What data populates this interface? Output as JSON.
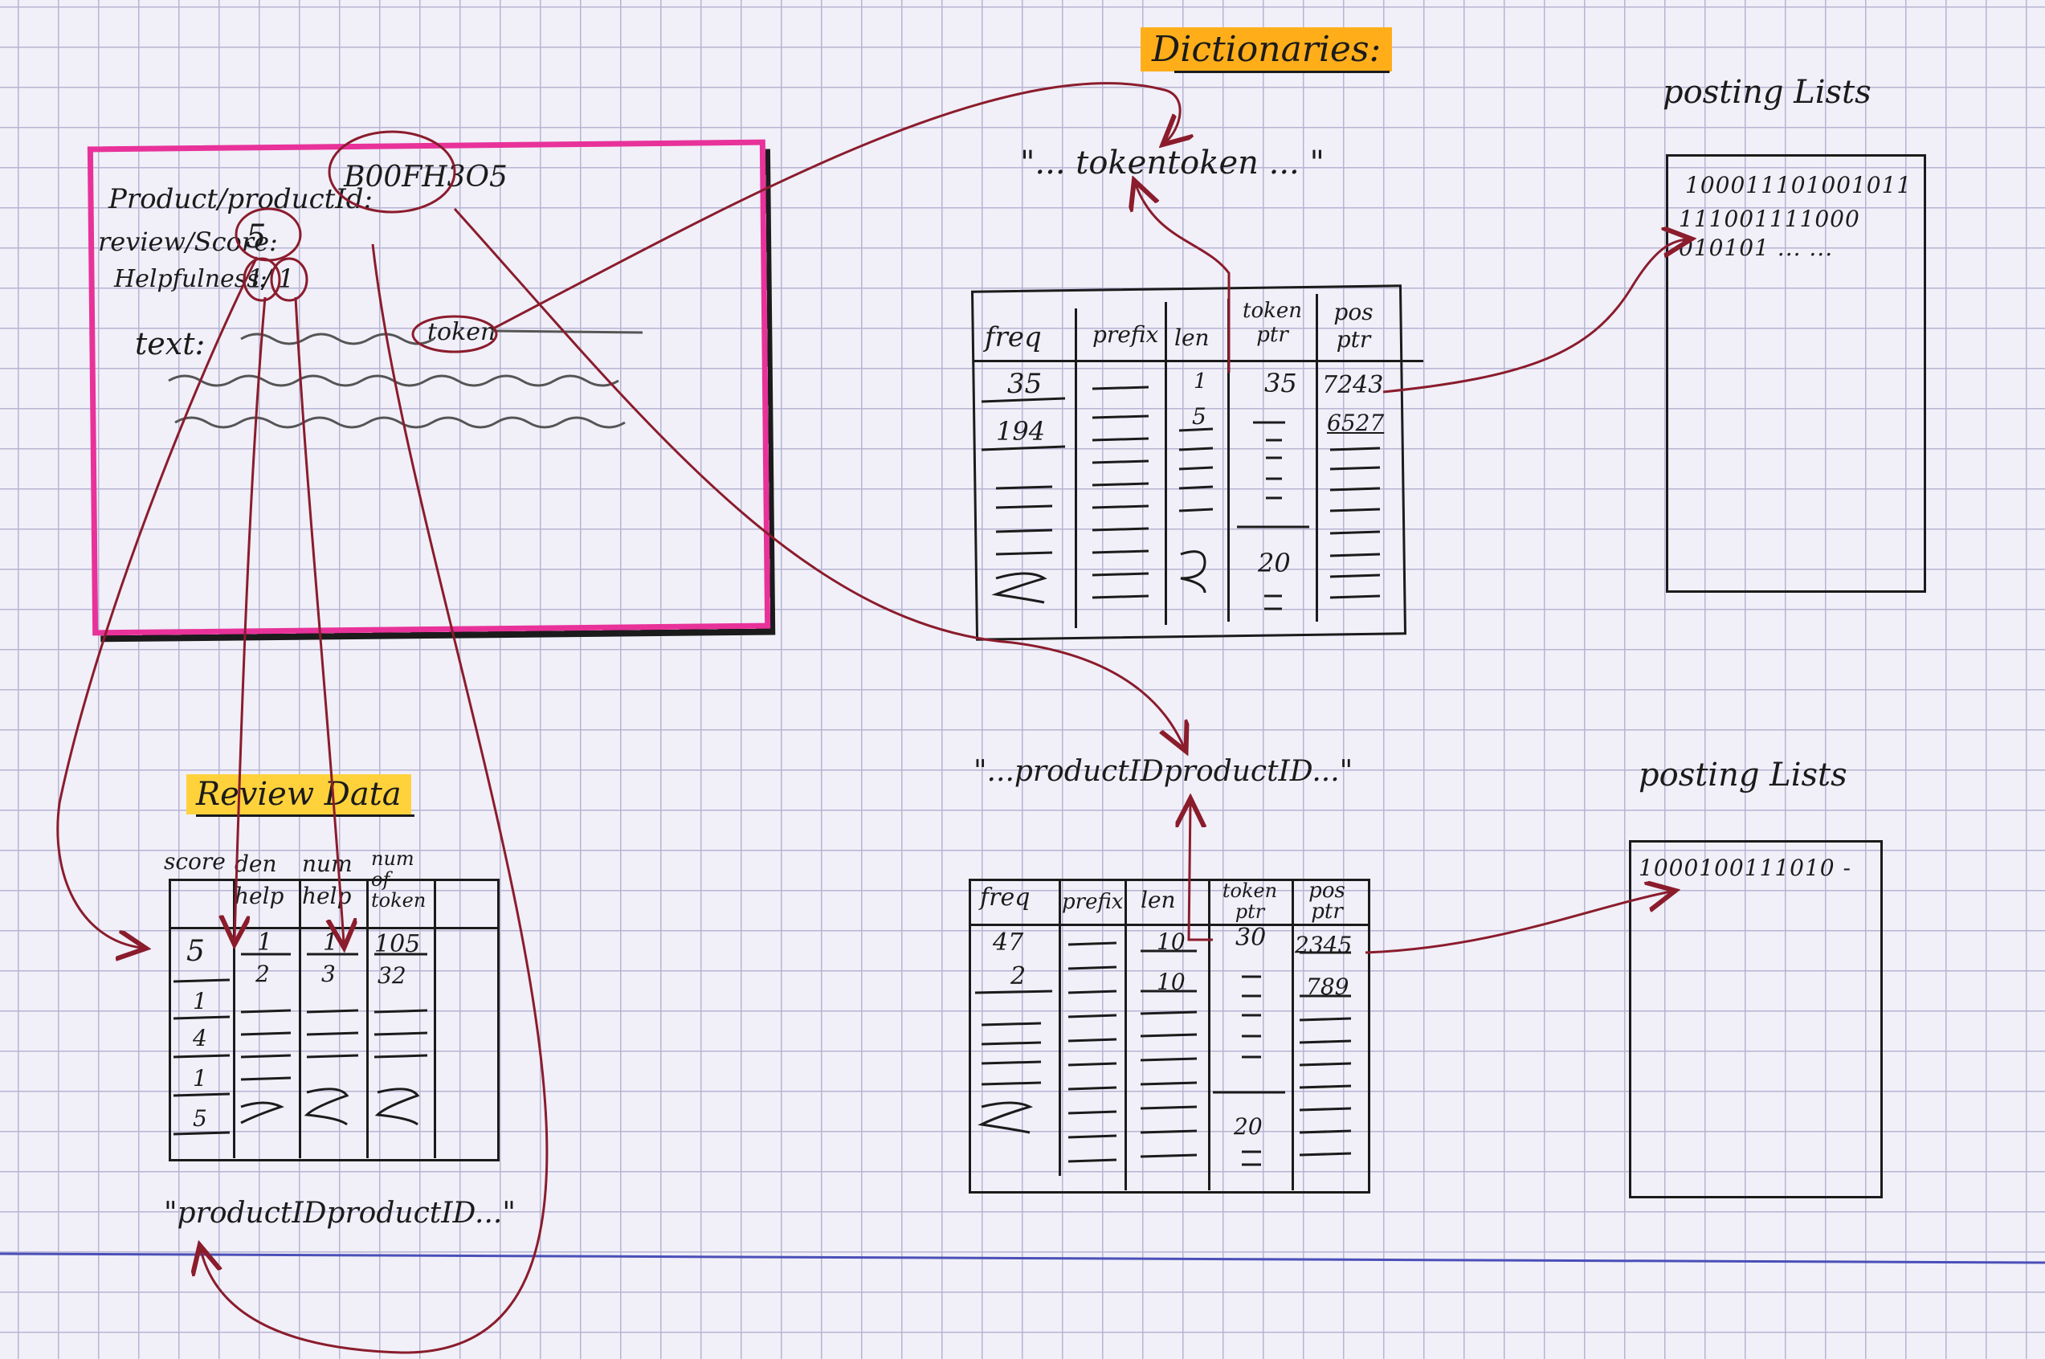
{
  "review_box": {
    "product_label": "Product/productId:",
    "product_value": "B00FH3O5",
    "score_label": "review/Score:",
    "score_value": "5",
    "helpfulness_label": "Helpfulness:",
    "helpfulness_num": "1",
    "helpfulness_den": "1",
    "text_label": "text:",
    "token_word": "token"
  },
  "dictionaries": {
    "title": "Dictionaries:",
    "token_string": "\"... tokentoken ... \"",
    "product_string": "\"...productIDproductID...\"",
    "columns_token": [
      "freq",
      "prefix",
      "len",
      "token ptr",
      "pos ptr"
    ],
    "columns_product": [
      "freq",
      "prefix",
      "len",
      "token ptr",
      "pos ptr"
    ],
    "token_rows": [
      [
        "35",
        "",
        "1",
        "35",
        "7243"
      ],
      [
        "194",
        "",
        "5",
        "",
        "6527"
      ]
    ],
    "token_extra_ptr": "20",
    "product_rows": [
      [
        "47",
        "",
        "10",
        "30",
        "2345"
      ],
      [
        "2",
        "",
        "10",
        "",
        "789"
      ]
    ],
    "product_extra_ptr": "20"
  },
  "posting_lists": {
    "title_top": "posting Lists",
    "title_bottom": "posting Lists",
    "top_lines": [
      "100011101001011",
      "111001111000",
      "010101 ... ..."
    ],
    "bottom_lines": [
      "1000100111010 -"
    ]
  },
  "review_data": {
    "title": "Review Data",
    "columns": [
      "score",
      "den help",
      "num help",
      "num of token"
    ],
    "rows": [
      [
        "5",
        "1",
        "1",
        "105"
      ],
      [
        "",
        "2",
        "3",
        "32"
      ]
    ],
    "extra_scores": [
      "1",
      "4",
      "1",
      "5"
    ],
    "product_string": "\"productIDproductID...\""
  },
  "colors": {
    "review_border": "#e8329a",
    "arrow": "#8a1c2c",
    "ink": "#1b1b1b",
    "highlight_orange": "#ffae1a",
    "highlight_yellow": "#ffd23c"
  }
}
